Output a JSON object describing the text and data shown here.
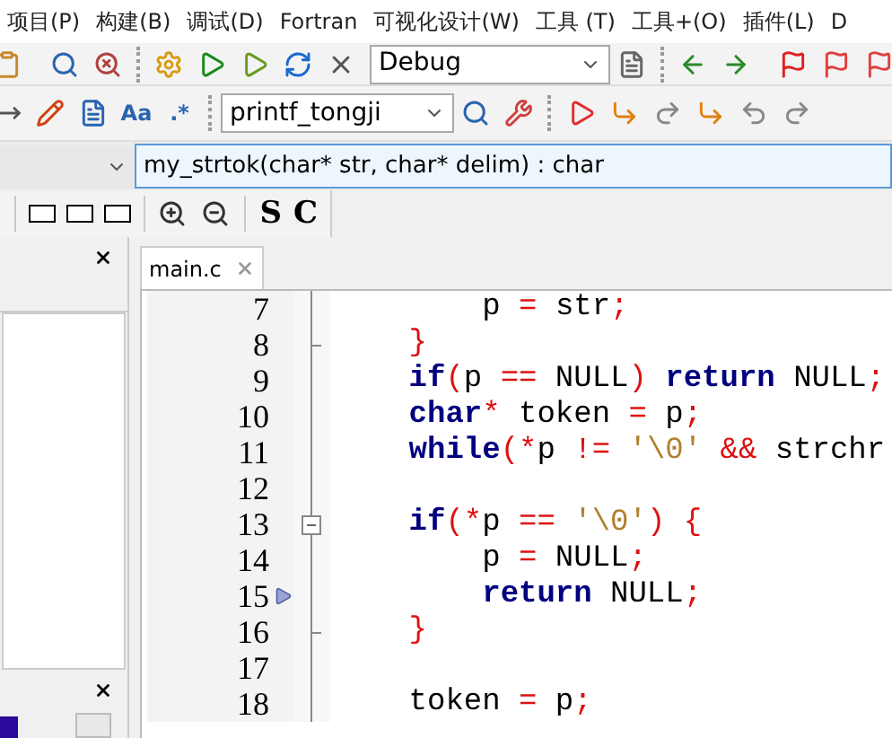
{
  "menu": [
    "项目(P)",
    "构建(B)",
    "调试(D)",
    "Fortran",
    "可视化设计(W)",
    "工具 (T)",
    "工具+(O)",
    "插件(L)",
    "D"
  ],
  "build_target": {
    "value": "Debug"
  },
  "search_toolbar": {
    "aa_label": "Aa",
    "regex_label": ".*",
    "function_combo": {
      "value": "printf_tongji"
    }
  },
  "symbol_bar": {
    "symbol": {
      "value": "my_strtok(char* str, char* delim) : char"
    }
  },
  "view_toolbar": {
    "s_label": "S",
    "c_label": "C"
  },
  "tabs": [
    {
      "label": "main.c",
      "selected": true
    }
  ],
  "code_lines": [
    {
      "number": "7",
      "current": false,
      "fold_start": false,
      "fold_end": false,
      "tokens": [
        {
          "text": "        p",
          "kind": "id"
        },
        {
          "text": " = ",
          "kind": "op"
        },
        {
          "text": "str",
          "kind": "id"
        },
        {
          "text": ";",
          "kind": "op"
        }
      ]
    },
    {
      "number": "8",
      "current": false,
      "fold_start": false,
      "fold_end": true,
      "tokens": [
        {
          "text": "    }",
          "kind": "op"
        }
      ]
    },
    {
      "number": "9",
      "current": false,
      "fold_start": false,
      "fold_end": false,
      "tokens": [
        {
          "text": "    if",
          "kind": "kw"
        },
        {
          "text": "(",
          "kind": "op"
        },
        {
          "text": "p ",
          "kind": "id"
        },
        {
          "text": "==",
          "kind": "op"
        },
        {
          "text": " NULL",
          "kind": "id"
        },
        {
          "text": ") ",
          "kind": "op"
        },
        {
          "text": "return",
          "kind": "kw"
        },
        {
          "text": " NULL",
          "kind": "id"
        },
        {
          "text": ";",
          "kind": "op"
        }
      ]
    },
    {
      "number": "10",
      "current": false,
      "fold_start": false,
      "fold_end": false,
      "tokens": [
        {
          "text": "    char",
          "kind": "kw"
        },
        {
          "text": "*",
          "kind": "op"
        },
        {
          "text": " token ",
          "kind": "id"
        },
        {
          "text": "=",
          "kind": "op"
        },
        {
          "text": " p",
          "kind": "id"
        },
        {
          "text": ";",
          "kind": "op"
        }
      ]
    },
    {
      "number": "11",
      "current": false,
      "fold_start": false,
      "fold_end": false,
      "tokens": [
        {
          "text": "    while",
          "kind": "kw"
        },
        {
          "text": "(*",
          "kind": "op"
        },
        {
          "text": "p ",
          "kind": "id"
        },
        {
          "text": "!= ",
          "kind": "op"
        },
        {
          "text": "'\\0' ",
          "kind": "str"
        },
        {
          "text": "&&",
          "kind": "op"
        },
        {
          "text": " strchr",
          "kind": "id"
        }
      ]
    },
    {
      "number": "12",
      "current": false,
      "fold_start": false,
      "fold_end": false
    },
    {
      "number": "13",
      "current": false,
      "fold_start": true,
      "fold_end": false,
      "tokens": [
        {
          "text": "    if",
          "kind": "kw"
        },
        {
          "text": "(*",
          "kind": "op"
        },
        {
          "text": "p ",
          "kind": "id"
        },
        {
          "text": "== ",
          "kind": "op"
        },
        {
          "text": "'\\0'",
          "kind": "str"
        },
        {
          "text": ") {",
          "kind": "op"
        }
      ]
    },
    {
      "number": "14",
      "current": false,
      "fold_start": false,
      "fold_end": false,
      "tokens": [
        {
          "text": "        p ",
          "kind": "id"
        },
        {
          "text": "=",
          "kind": "op"
        },
        {
          "text": " NULL",
          "kind": "id"
        },
        {
          "text": ";",
          "kind": "op"
        }
      ]
    },
    {
      "number": "15",
      "current": true,
      "fold_start": false,
      "fold_end": false,
      "tokens": [
        {
          "text": "        return",
          "kind": "kw"
        },
        {
          "text": " NULL",
          "kind": "id"
        },
        {
          "text": ";",
          "kind": "op"
        }
      ]
    },
    {
      "number": "16",
      "current": false,
      "fold_start": false,
      "fold_end": true,
      "tokens": [
        {
          "text": "    }",
          "kind": "op"
        }
      ]
    },
    {
      "number": "17",
      "current": false,
      "fold_start": false,
      "fold_end": false
    },
    {
      "number": "18",
      "current": false,
      "fold_start": false,
      "fold_end": false,
      "tokens": [
        {
          "text": "    token ",
          "kind": "id"
        },
        {
          "text": "=",
          "kind": "op"
        },
        {
          "text": " p",
          "kind": "id"
        },
        {
          "text": ";",
          "kind": "op"
        }
      ]
    }
  ]
}
